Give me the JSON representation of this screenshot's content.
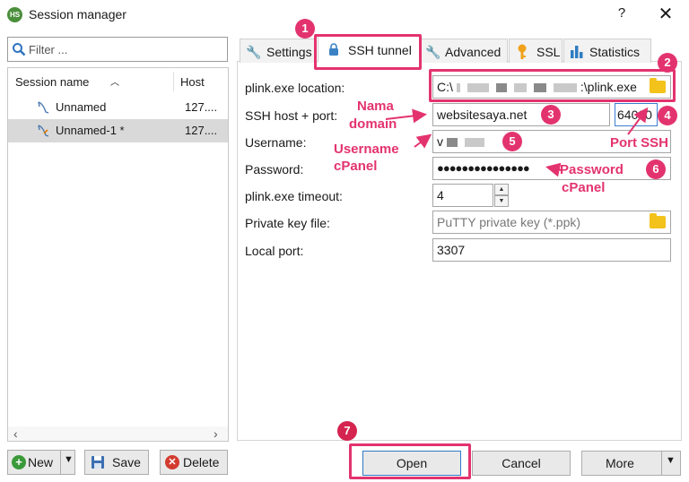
{
  "window": {
    "icon_text": "HS",
    "title": "Session manager",
    "help_label": "?",
    "close_label": "✕"
  },
  "filter": {
    "placeholder": "Filter ..."
  },
  "sessions": {
    "columns": {
      "name": "Session name",
      "host": "Host"
    },
    "rows": [
      {
        "name": "Unnamed",
        "host": "127...."
      },
      {
        "name": "Unnamed-1 *",
        "host": "127...."
      }
    ]
  },
  "left_buttons": {
    "new": "New",
    "save": "Save",
    "delete": "Delete"
  },
  "tabs": {
    "settings": "Settings",
    "ssh_tunnel": "SSH tunnel",
    "advanced": "Advanced",
    "ssl": "SSL",
    "statistics": "Statistics"
  },
  "form": {
    "plink_location_label": "plink.exe location:",
    "plink_location_start": "C:\\",
    "plink_location_end": ":\\plink.exe",
    "ssh_host_label": "SSH host + port:",
    "ssh_host_value": "websitesaya.net",
    "ssh_port_value": "64000",
    "username_label": "Username:",
    "username_start": "v",
    "password_label": "Password:",
    "password_value": "●●●●●●●●●●●●●●●",
    "timeout_label": "plink.exe timeout:",
    "timeout_value": "4",
    "private_key_label": "Private key file:",
    "private_key_placeholder": "PuTTY private key (*.ppk)",
    "local_port_label": "Local port:",
    "local_port_value": "3307"
  },
  "bottom_buttons": {
    "open": "Open",
    "cancel": "Cancel",
    "more": "More"
  },
  "annotations": {
    "markers": [
      "1",
      "2",
      "3",
      "4",
      "5",
      "6",
      "7"
    ],
    "nama_domain_1": "Nama",
    "nama_domain_2": "domain",
    "port_ssh": "Port SSH",
    "username_cpanel_1": "Username",
    "username_cpanel_2": "cPanel",
    "password_cpanel_1": "Password",
    "password_cpanel_2": "cPanel",
    "color": "#e3336f"
  }
}
